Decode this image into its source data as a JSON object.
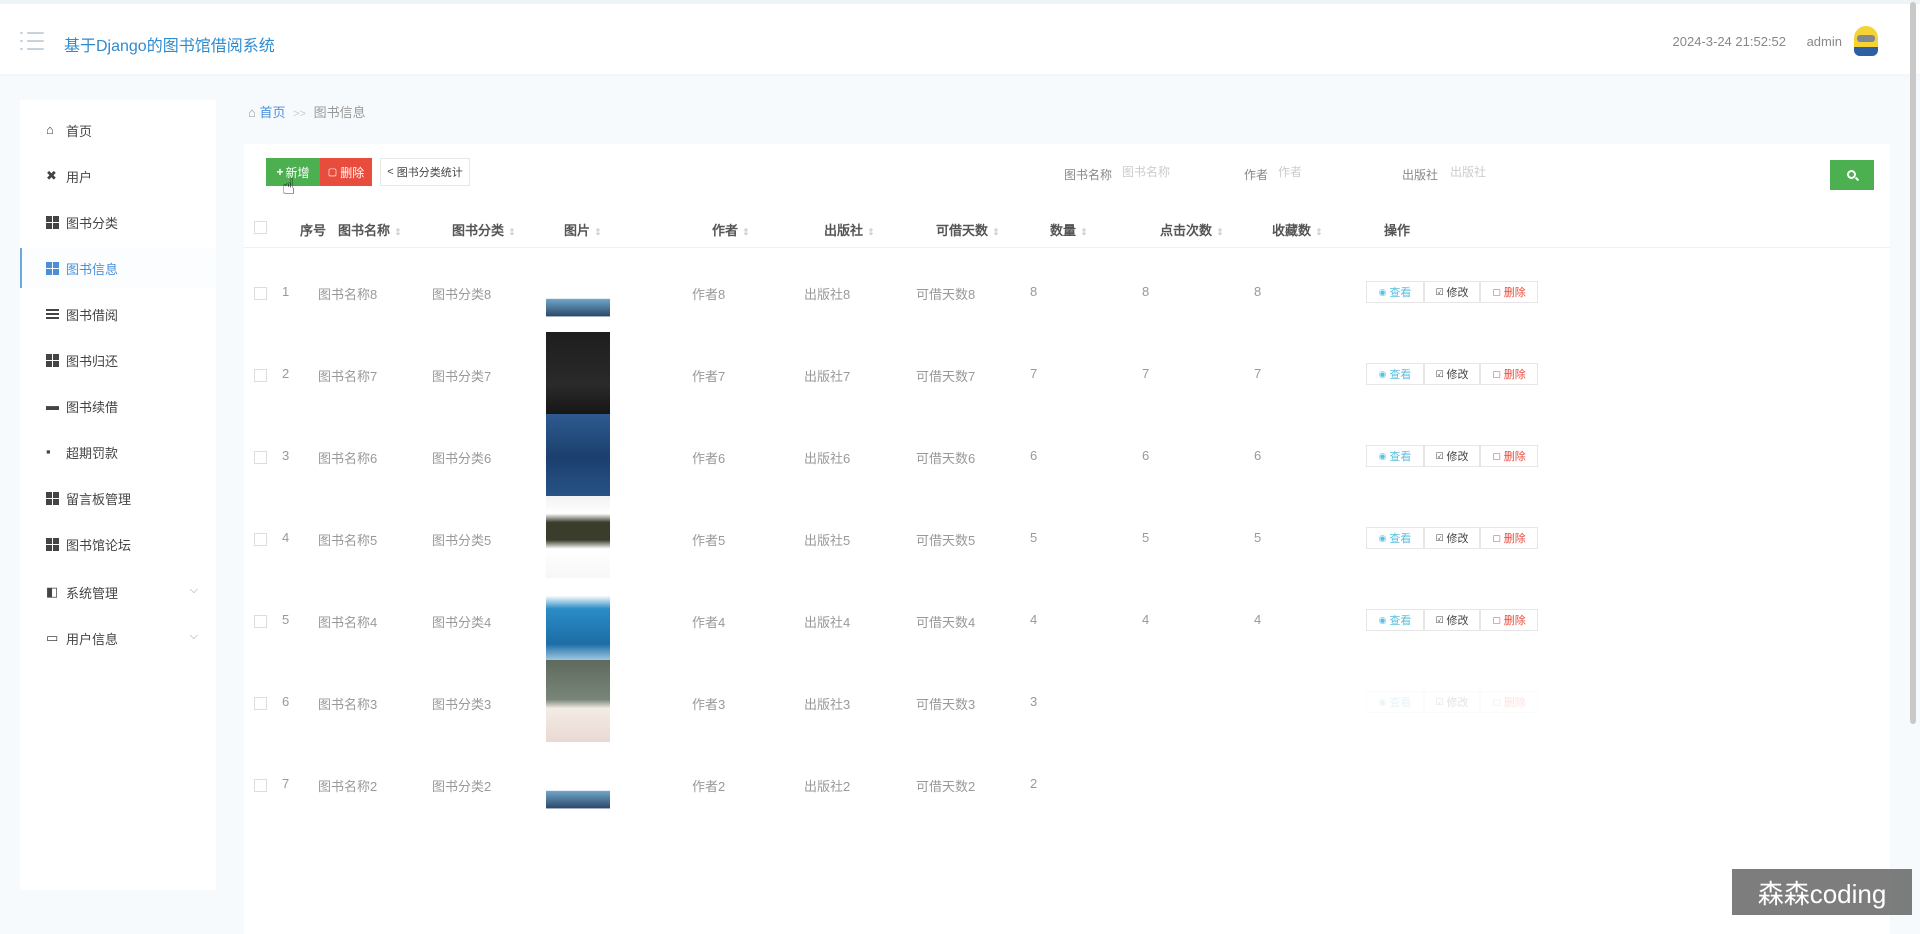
{
  "header": {
    "title": "基于Django的图书馆借阅系统",
    "datetime": "2024-3-24 21:52:52",
    "username": "admin"
  },
  "sidebar": {
    "items": [
      {
        "label": "首页",
        "icon": "home-icon"
      },
      {
        "label": "用户",
        "icon": "user-icon"
      },
      {
        "label": "图书分类",
        "icon": "grid-icon"
      },
      {
        "label": "图书信息",
        "icon": "grid-icon",
        "active": true
      },
      {
        "label": "图书借阅",
        "icon": "list-icon"
      },
      {
        "label": "图书归还",
        "icon": "grid-icon"
      },
      {
        "label": "图书续借",
        "icon": "monitor-icon"
      },
      {
        "label": "超期罚款",
        "icon": "message-icon"
      },
      {
        "label": "留言板管理",
        "icon": "grid-icon"
      },
      {
        "label": "图书馆论坛",
        "icon": "grid-icon"
      },
      {
        "label": "系统管理",
        "icon": "settings-icon",
        "expandable": true
      },
      {
        "label": "用户信息",
        "icon": "card-icon",
        "expandable": true
      }
    ]
  },
  "breadcrumb": {
    "home": "首页",
    "separator": ">>",
    "current": "图书信息"
  },
  "toolbar": {
    "add_label": "新增",
    "delete_label": "删除",
    "stats_label": "图书分类统计"
  },
  "search": {
    "name_label": "图书名称",
    "name_placeholder": "图书名称",
    "author_label": "作者",
    "author_placeholder": "作者",
    "publisher_label": "出版社",
    "publisher_placeholder": "出版社"
  },
  "table": {
    "columns": [
      "序号",
      "图书名称",
      "图书分类",
      "图片",
      "作者",
      "出版社",
      "可借天数",
      "数量",
      "点击次数",
      "收藏数",
      "操作"
    ],
    "rows": [
      {
        "index": "1",
        "name": "图书名称8",
        "category": "图书分类8",
        "author": "作者8",
        "publisher": "出版社8",
        "days": "可借天数8",
        "quantity": "8",
        "clicks": "8",
        "favorites": "8",
        "cover": "book-cover-art"
      },
      {
        "index": "2",
        "name": "图书名称7",
        "category": "图书分类7",
        "author": "作者7",
        "publisher": "出版社7",
        "days": "可借天数7",
        "quantity": "7",
        "clicks": "7",
        "favorites": "7",
        "cover": "book-cover-dark"
      },
      {
        "index": "3",
        "name": "图书名称6",
        "category": "图书分类6",
        "author": "作者6",
        "publisher": "出版社6",
        "days": "可借天数6",
        "quantity": "6",
        "clicks": "6",
        "favorites": "6",
        "cover": "book-cover-blue"
      },
      {
        "index": "4",
        "name": "图书名称5",
        "category": "图书分类5",
        "author": "作者5",
        "publisher": "出版社5",
        "days": "可借天数5",
        "quantity": "5",
        "clicks": "5",
        "favorites": "5",
        "cover": "book-cover-white"
      },
      {
        "index": "5",
        "name": "图书名称4",
        "category": "图书分类4",
        "author": "作者4",
        "publisher": "出版社4",
        "days": "可借天数4",
        "quantity": "4",
        "clicks": "4",
        "favorites": "4",
        "cover": "book-cover-hr"
      },
      {
        "index": "6",
        "name": "图书名称3",
        "category": "图书分类3",
        "author": "作者3",
        "publisher": "出版社3",
        "days": "可借天数3",
        "quantity": "3",
        "clicks": "",
        "favorites": "",
        "cover": "book-cover-grey"
      },
      {
        "index": "7",
        "name": "图书名称2",
        "category": "图书分类2",
        "author": "作者2",
        "publisher": "出版社2",
        "days": "可借天数2",
        "quantity": "2",
        "clicks": "",
        "favorites": "",
        "cover": "book-cover-art"
      }
    ],
    "actions": {
      "view": "查看",
      "edit": "修改",
      "delete": "删除"
    }
  },
  "watermark": "森森coding",
  "colors": {
    "accent": "#2f8bd0",
    "add": "#4caf50",
    "danger": "#e74c3c",
    "view": "#5bc0de"
  }
}
